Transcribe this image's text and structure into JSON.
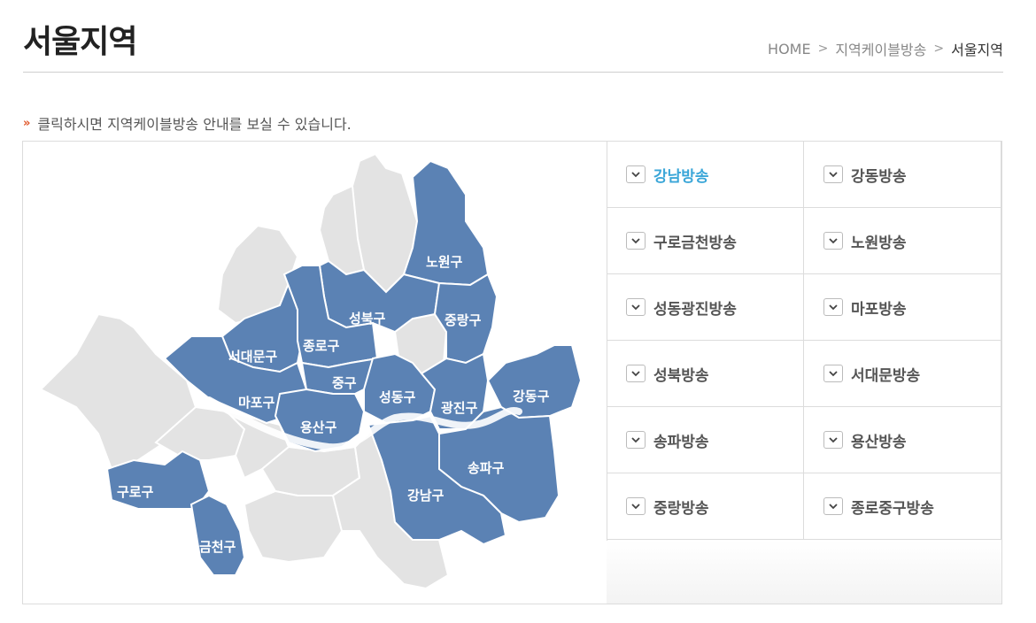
{
  "page": {
    "title": "서울지역",
    "breadcrumb": {
      "home": "HOME",
      "sep": ">",
      "level1": "지역케이블방송",
      "current": "서울지역"
    },
    "notice": "클릭하시면 지역케이블방송 안내를 보실 수 있습니다."
  },
  "map": {
    "highlight_color": "#5b82b4",
    "base_color": "#e3e3e3",
    "districts": [
      "노원구",
      "성북구",
      "중랑구",
      "서대문구",
      "종로구",
      "중구",
      "마포구",
      "성동구",
      "광진구",
      "강동구",
      "용산구",
      "송파구",
      "구로구",
      "강남구",
      "금천구"
    ]
  },
  "broadcasters": [
    {
      "label": "강남방송",
      "active": true
    },
    {
      "label": "강동방송"
    },
    {
      "label": "구로금천방송"
    },
    {
      "label": "노원방송"
    },
    {
      "label": "성동광진방송"
    },
    {
      "label": "마포방송"
    },
    {
      "label": "성북방송"
    },
    {
      "label": "서대문방송"
    },
    {
      "label": "송파방송"
    },
    {
      "label": "용산방송"
    },
    {
      "label": "중랑방송"
    },
    {
      "label": "종로중구방송"
    }
  ]
}
